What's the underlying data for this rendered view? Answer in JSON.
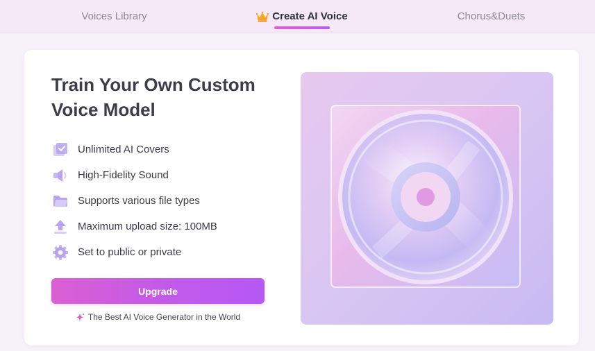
{
  "tabs": {
    "voices_library": "Voices Library",
    "create_ai_voice": "Create AI Voice",
    "chorus_duets": "Chorus&Duets",
    "active": "create_ai_voice"
  },
  "hero": {
    "title": "Train Your Own Custom Voice Model",
    "features": [
      {
        "label": "Unlimited AI Covers",
        "icon": "checkbox-icon"
      },
      {
        "label": "High-Fidelity Sound",
        "icon": "speaker-icon"
      },
      {
        "label": "Supports various file types",
        "icon": "folder-icon"
      },
      {
        "label": "Maximum upload size: 100MB",
        "icon": "upload-icon"
      },
      {
        "label": "Set to public or private",
        "icon": "gear-icon"
      }
    ],
    "upgrade_label": "Upgrade",
    "tagline": "The Best AI Voice Generator in the World"
  },
  "colors": {
    "accent_start": "#da5fd2",
    "accent_end": "#b658f5",
    "crown": "#f5a623",
    "icon_purple": "#b9a3f0"
  }
}
